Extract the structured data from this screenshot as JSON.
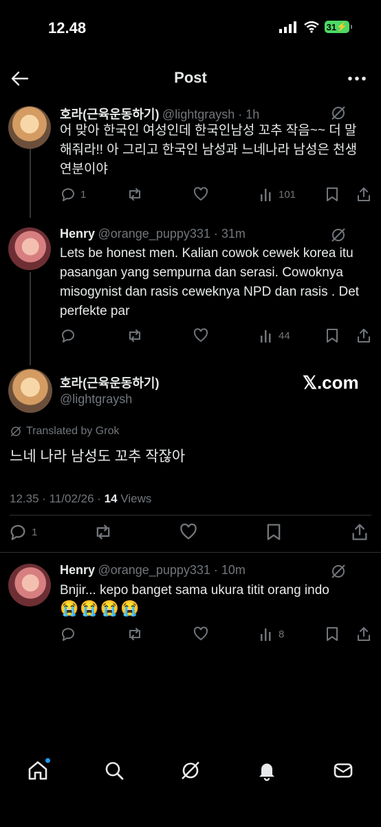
{
  "status": {
    "time": "12.48",
    "battery": "31"
  },
  "nav": {
    "title": "Post"
  },
  "posts": [
    {
      "name": "호라(근육운동하기)",
      "handle": "@lightgraysh · 1h",
      "text": "어 맞아 한국인 여성인데 한국인남성 꼬추 작음~~ 더 말해줘라!! 아 그리고 한국인 남성과 느네나라 남성은 천생연분이야",
      "replies": "1",
      "views": "101"
    },
    {
      "name": "Henry",
      "handle": "@orange_puppy331 · 31m",
      "text": "Lets be honest men. Kalian cowok cewek korea itu pasangan yang sempurna dan serasi. Cowoknya misogynist dan rasis ceweknya NPD dan rasis . Det perfekte par",
      "views": "44"
    }
  ],
  "main_post": {
    "name": "호라(근육운동하기)",
    "handle": "@lightgraysh",
    "source_logo": "𝕏.com",
    "translated_label": "Translated by Grok",
    "text": "느네 나라 남성도 꼬추 작잖아",
    "datetime": "12.35 · 11/02/26 · ",
    "views_count": "14",
    "views_label": " Views",
    "replies": "1"
  },
  "reply": {
    "name": "Henry",
    "handle": "@orange_puppy331 · 10m",
    "text": "Bnjir... kepo banget sama ukura titit orang indo",
    "emojis": "😭😭😭😭",
    "views": "8"
  },
  "colors": {
    "background": "#000000",
    "text": "#e7e9ea",
    "muted": "#71767b",
    "accent": "#1d9bf0"
  }
}
